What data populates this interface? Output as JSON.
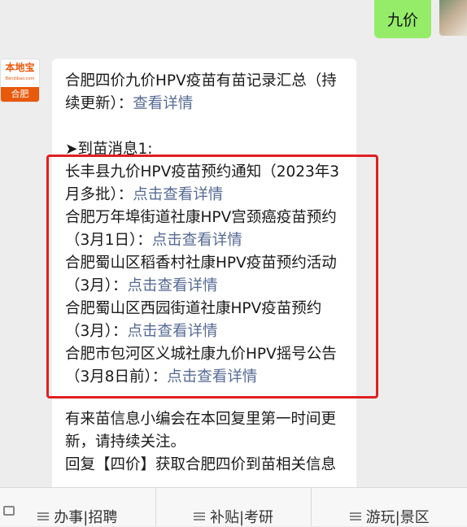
{
  "user_message": "九价",
  "bot": {
    "avatar_brand": "本地宝",
    "avatar_brand_small": "Bendibao.com",
    "avatar_city": "合肥"
  },
  "message": {
    "intro_text": "合肥四价九价HPV疫苗有苗记录汇总（持续更新）：",
    "intro_link": "查看详情",
    "section_title": "➤到苗消息1:",
    "items": [
      {
        "text": "长丰县九价HPV疫苗预约通知（2023年3月多批）：",
        "link": "点击查看详情"
      },
      {
        "text": "合肥万年埠街道社康HPV宫颈癌疫苗预约（3月1日）：",
        "link": "点击查看详情"
      },
      {
        "text": "合肥蜀山区稻香村社康HPV疫苗预约活动（3月）：",
        "link": "点击查看详情"
      },
      {
        "text": "合肥蜀山区西园街道社康HPV疫苗预约（3月）：",
        "link": "点击查看详情"
      },
      {
        "text": "合肥市包河区义城社康九价HPV摇号公告（3月8日前）：",
        "link": "点击查看详情"
      }
    ],
    "footer_1": "有来苗信息小编会在本回复里第一时间更新，请持续关注。",
    "footer_2": "回复【四价】获取合肥四价到苗相关信息"
  },
  "bottom_nav": [
    {
      "label": "办事|招聘"
    },
    {
      "label": "补贴|考研"
    },
    {
      "label": "游玩|景区"
    }
  ],
  "colors": {
    "link": "#576b95",
    "highlight": "#e02020",
    "user_bubble": "#95ec69"
  }
}
